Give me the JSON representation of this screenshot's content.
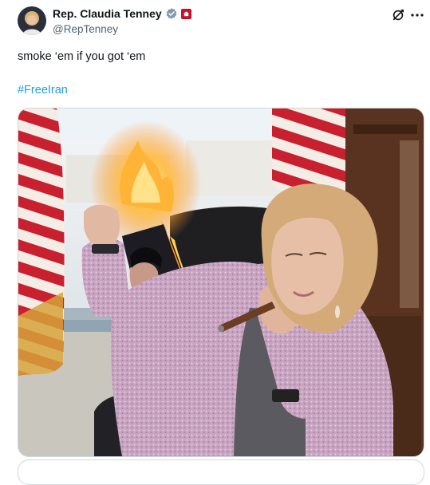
{
  "author": {
    "display_name": "Rep. Claudia Tenney",
    "handle": "@RepTenney",
    "avatar_icon": "avatar-photo",
    "verified_icon": "verified-badge-icon",
    "affiliation_icon": "government-badge-icon",
    "verified_color": "#829aab",
    "affiliation_color": "#c8102e"
  },
  "header_actions": {
    "grok_icon": "grok-icon",
    "more_icon": "more-horizontal-icon"
  },
  "post": {
    "text": "smoke ‘em if you got ‘em",
    "hashtag": "#FreeIran",
    "link_color": "#1d9bf0"
  },
  "media": {
    "type": "photo"
  }
}
